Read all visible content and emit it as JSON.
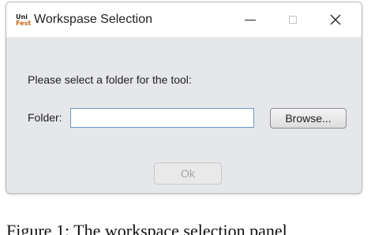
{
  "window": {
    "app_icon_text": [
      "Uni",
      "Fest"
    ],
    "title": "Workspase Selection",
    "controls": {
      "minimize": "minimize-icon",
      "maximize": "maximize-icon",
      "close": "close-icon",
      "close_glyph": "✕"
    }
  },
  "dialog": {
    "prompt": "Please select a folder for the tool:",
    "folder_label": "Folder:",
    "folder_value": "",
    "browse_label": "Browse...",
    "ok_label": "Ok"
  },
  "caption": "Figure 1: The workspace selection panel"
}
